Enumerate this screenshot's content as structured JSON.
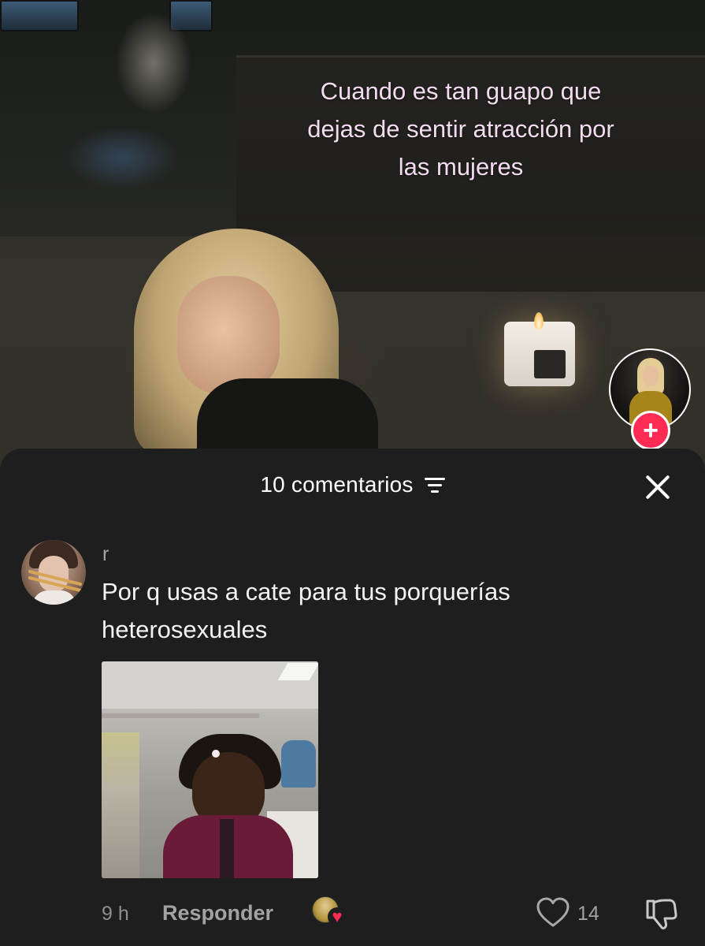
{
  "video": {
    "caption": "Cuando es tan guapo que\ndejas de sentir atracción por\nlas mujeres"
  },
  "creator": {
    "follow_glyph": "+",
    "accent_color": "#fe2c55"
  },
  "comments_sheet": {
    "count_label": "10 comentarios",
    "sort_icon": "sort-lines-icon",
    "close_icon": "close-x-icon",
    "comments": [
      {
        "username": "r",
        "text": "Por q usas a cate para tus porquerías\nheterosexuales",
        "attachment": "gif",
        "time": "9 h",
        "reply_label": "Responder",
        "liked_by_creator": true,
        "likes": "14",
        "like_icon": "heart-outline-icon",
        "dislike_icon": "thumbs-down-icon"
      }
    ]
  }
}
